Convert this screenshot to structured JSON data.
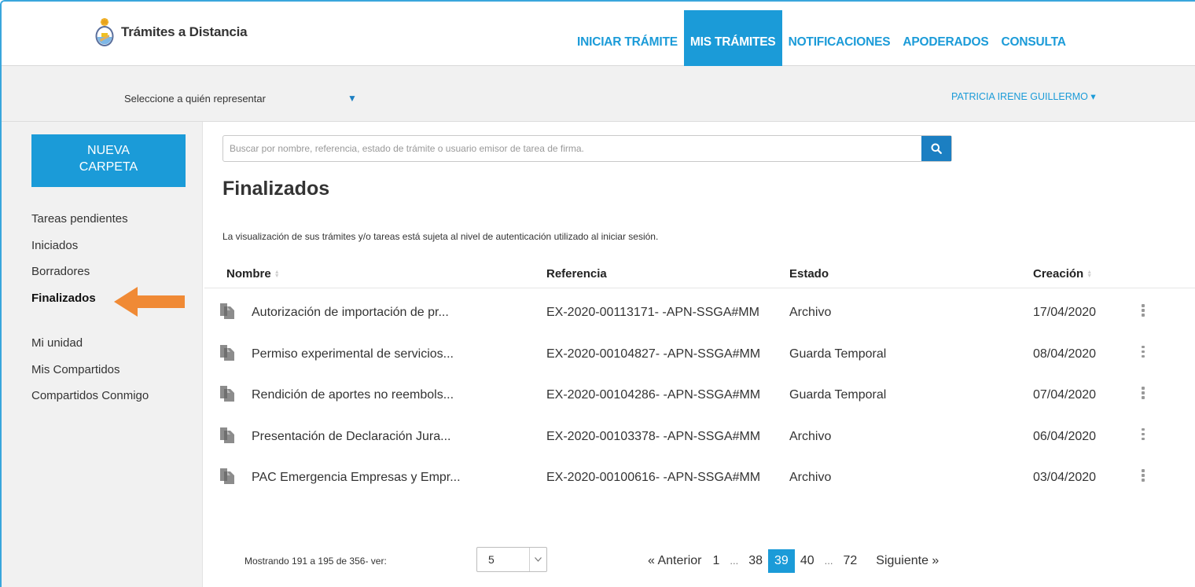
{
  "header": {
    "logo_text": "Trámites a Distancia",
    "nav": [
      {
        "label": "INICIAR TRÁMITE",
        "active": false
      },
      {
        "label": "MIS TRÁMITES",
        "active": true
      },
      {
        "label": "NOTIFICACIONES",
        "active": false
      },
      {
        "label": "APODERADOS",
        "active": false
      },
      {
        "label": "CONSULTA",
        "active": false
      }
    ]
  },
  "represent": {
    "label": "Seleccione a quién representar",
    "arrow": "▼",
    "user_name": "PATRICIA IRENE GUILLERMO",
    "user_caret": "▾"
  },
  "sidebar": {
    "new_folder_line1": "NUEVA",
    "new_folder_line2": "CARPETA",
    "items_top": [
      "Tareas pendientes",
      "Iniciados",
      "Borradores",
      "Finalizados"
    ],
    "items_bottom": [
      "Mi unidad",
      "Mis Compartidos",
      "Compartidos Conmigo"
    ],
    "active_item": "Finalizados"
  },
  "search": {
    "placeholder": "Buscar por nombre, referencia, estado de trámite o usuario emisor de tarea de firma."
  },
  "main": {
    "title": "Finalizados",
    "notice": "La visualización de sus trámites y/o tareas está sujeta al nivel de autenticación utilizado al iniciar sesión."
  },
  "table": {
    "headers": {
      "name": "Nombre",
      "reference": "Referencia",
      "status": "Estado",
      "created": "Creación"
    },
    "rows": [
      {
        "name": "Autorización de importación de pr...",
        "reference": "EX-2020-00113171- -APN-SSGA#MM",
        "status": "Archivo",
        "created": "17/04/2020"
      },
      {
        "name": "Permiso experimental de servicios...",
        "reference": "EX-2020-00104827- -APN-SSGA#MM",
        "status": "Guarda Temporal",
        "created": "08/04/2020"
      },
      {
        "name": "Rendición de aportes no reembols...",
        "reference": "EX-2020-00104286- -APN-SSGA#MM",
        "status": "Guarda Temporal",
        "created": "07/04/2020"
      },
      {
        "name": "Presentación de Declaración Jura...",
        "reference": "EX-2020-00103378- -APN-SSGA#MM",
        "status": "Archivo",
        "created": "06/04/2020"
      },
      {
        "name": "PAC Emergencia Empresas y Empr...",
        "reference": "EX-2020-00100616- -APN-SSGA#MM",
        "status": "Archivo",
        "created": "03/04/2020"
      }
    ]
  },
  "footer": {
    "count_label": "Mostrando 191 a 195 de 356- ver:",
    "page_size": "5",
    "pagination": {
      "prev": "« Anterior",
      "pages": [
        "1",
        "...",
        "38",
        "39",
        "40",
        "...",
        "72"
      ],
      "current": "39",
      "next": "Siguiente »"
    }
  },
  "colors": {
    "accent": "#1b9bd8",
    "arrow": "#f08a35",
    "search_button": "#1b7fc2"
  },
  "icons": [
    "argentina-seal-icon",
    "search-icon",
    "document-icon",
    "kebab-menu-icon",
    "sort-icon",
    "chevron-down-icon",
    "arrow-pointer-icon"
  ]
}
